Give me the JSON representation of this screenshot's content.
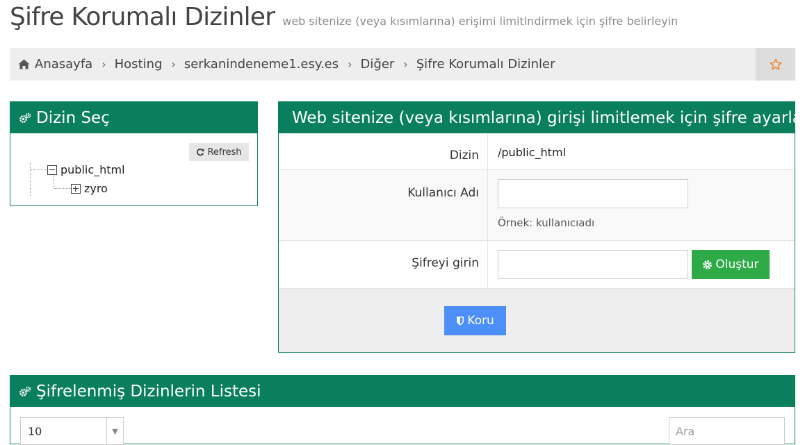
{
  "page": {
    "title": "Şifre Korumalı Dizinler",
    "subtitle": "web sitenize (veya kısımlarına) erişimi limitlndirmek için şifre belirleyin"
  },
  "breadcrumb": {
    "items": [
      "Anasayfa",
      "Hosting",
      "serkanindeneme1.esy.es",
      "Diğer",
      "Şifre Korumalı Dizinler"
    ],
    "separator": "›"
  },
  "dir_panel": {
    "title": "Dizin Seç",
    "refresh_label": "Refresh",
    "tree": {
      "root": "public_html",
      "children": [
        "zyro"
      ]
    }
  },
  "form_panel": {
    "title": "Web sitenize (veya kısımlarına) girişi limitlemek için şifre ayarlayın",
    "dir_label": "Dizin",
    "dir_value": "/public_html",
    "username_label": "Kullanıcı Adı",
    "username_value": "",
    "username_help": "Örnek: kullanıcıadı",
    "password_label": "Şifreyi girin",
    "password_value": "",
    "create_label": "Oluştur",
    "protect_label": "Koru"
  },
  "list_panel": {
    "title": "Şifrelenmiş Dizinlerin Listesi",
    "page_length": "10",
    "search_placeholder": "Ara"
  },
  "colors": {
    "panel_green": "#0a7f5e",
    "create_green": "#2eaa47",
    "protect_blue": "#4c8ff8",
    "star_orange": "#f0811f"
  },
  "icons": [
    "home-icon",
    "star-icon",
    "gears-icon",
    "refresh-icon",
    "gear-icon",
    "shield-icon"
  ]
}
